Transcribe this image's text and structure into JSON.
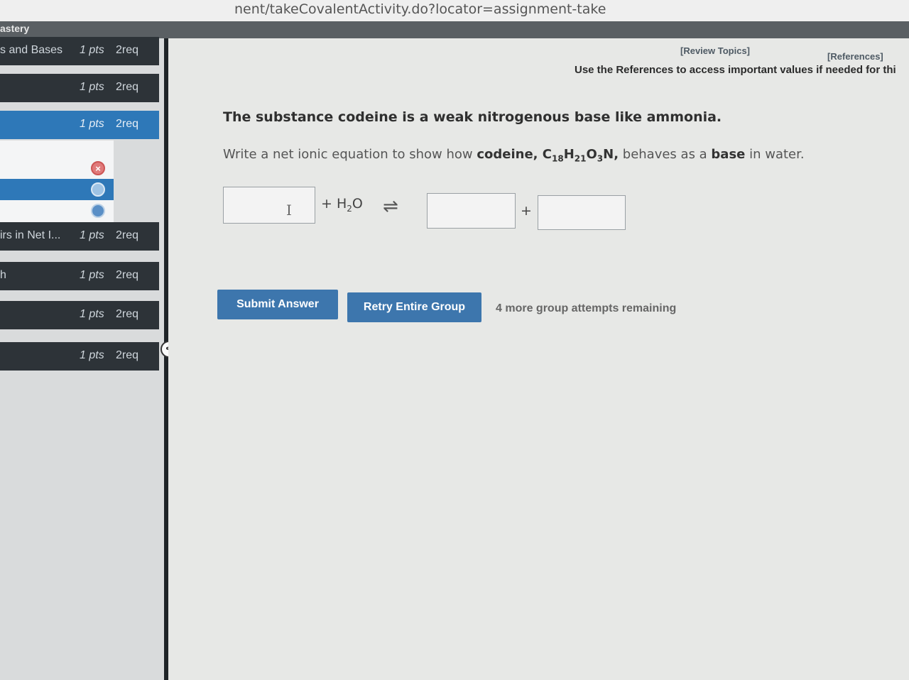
{
  "browser": {
    "url_fragment": "nent/takeCovalentActivity.do?locator=assignment-take"
  },
  "top_strip": {
    "title": "astery"
  },
  "sidebar": {
    "items": [
      {
        "name": "s and Bases",
        "pts": "1 pts",
        "req": "2req",
        "active": false
      },
      {
        "name": "",
        "pts": "1 pts",
        "req": "2req",
        "active": false
      },
      {
        "name": "",
        "pts": "1 pts",
        "req": "2req",
        "active": true
      },
      {
        "name": "irs in Net I...",
        "pts": "1 pts",
        "req": "2req",
        "active": false
      },
      {
        "name": "h",
        "pts": "1 pts",
        "req": "2req",
        "active": false
      },
      {
        "name": "",
        "pts": "1 pts",
        "req": "2req",
        "active": false
      },
      {
        "name": "",
        "pts": "1 pts",
        "req": "2req",
        "active": false
      }
    ],
    "collapse_glyph": "<"
  },
  "header": {
    "review_topics": "[Review Topics]",
    "references": "[References]",
    "note": "Use the References to access important values if needed for thi"
  },
  "question": {
    "statement": "The substance codeine is a weak nitrogenous base like ammonia.",
    "prompt_start": "Write a net ionic equation to show how ",
    "prompt_bold": "codeine, C",
    "sub1": "18",
    "h": "H",
    "sub2": "21",
    "o": "O",
    "sub3": "3",
    "n_comma": "N,",
    "prompt_mid": " behaves as a ",
    "prompt_base": "base",
    "prompt_end": " in water.",
    "plus_water": "+ H",
    "water_sub": "2",
    "water_o": "O",
    "equilibrium": "⇌",
    "plus": "+",
    "cursor_glyph": "I"
  },
  "actions": {
    "submit": "Submit Answer",
    "retry": "Retry Entire Group",
    "attempts": "4 more group attempts remaining"
  }
}
